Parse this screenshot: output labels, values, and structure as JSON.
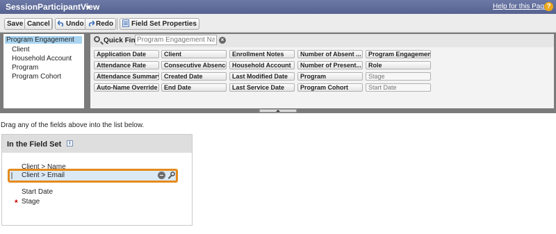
{
  "header": {
    "title": "SessionParticipantView",
    "help_link": "Help for this Page",
    "help_icon": "?"
  },
  "toolbar": {
    "save": "Save",
    "cancel": "Cancel",
    "undo": "Undo",
    "redo": "Redo",
    "field_set_properties": "Field Set Properties"
  },
  "objects": {
    "selected": "Program Engagement",
    "items": [
      "Client",
      "Household Account",
      "Program",
      "Program Cohort"
    ]
  },
  "quick_find": {
    "label": "Quick Find",
    "placeholder": "Program Engagement Name"
  },
  "fields": [
    [
      "Application Date",
      "Client",
      "Enrollment Notes",
      "Number of Absent ...",
      "Program Engagemen..."
    ],
    [
      "Attendance Rate",
      "Consecutive Absences",
      "Household Account",
      "Number of Present...",
      "Role"
    ],
    [
      "Attendance Summary",
      "Created Date",
      "Last Modified Date",
      "Program",
      "Stage"
    ],
    [
      "Auto-Name Override",
      "End Date",
      "Last Service Date",
      "Program Cohort",
      "Start Date"
    ]
  ],
  "hint": "Drag any of the fields above into the list below.",
  "field_set": {
    "title": "In the Field Set",
    "items": [
      "Client > Name",
      "Client > Email",
      "Start Date",
      "Stage"
    ],
    "required_marker": "*"
  }
}
